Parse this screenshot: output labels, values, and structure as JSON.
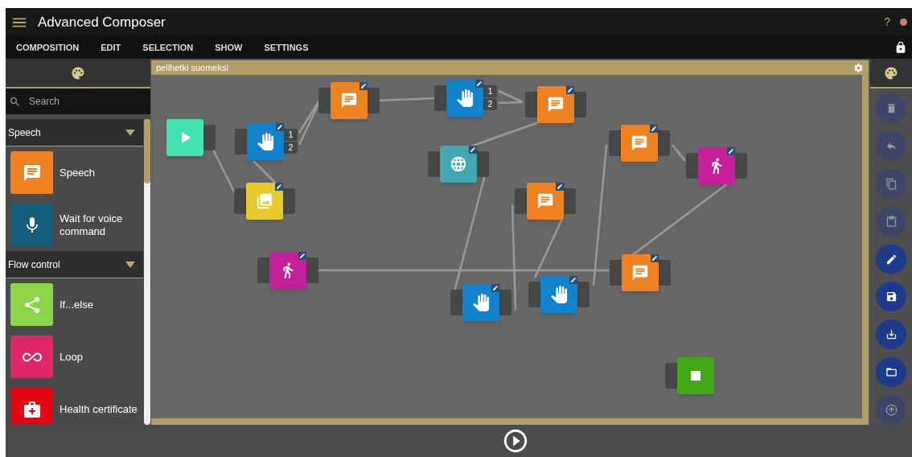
{
  "window": {
    "title": "Advanced Composer"
  },
  "title_bar": {
    "help": "?"
  },
  "menu": [
    "COMPOSITION",
    "EDIT",
    "SELECTION",
    "SHOW",
    "SETTINGS"
  ],
  "palette": {
    "search": {
      "placeholder": "Search"
    },
    "categories": [
      {
        "title": "Speech",
        "expanded": true,
        "items": [
          {
            "kind": "speech",
            "label": "Speech"
          },
          {
            "kind": "voice",
            "label": "Wait for voice command"
          }
        ]
      },
      {
        "title": "Flow control",
        "expanded": true,
        "items": [
          {
            "kind": "ifelse",
            "label": "If...else"
          },
          {
            "kind": "loop",
            "label": "Loop"
          },
          {
            "kind": "health",
            "label": "Health certificate"
          }
        ]
      }
    ]
  },
  "canvas": {
    "title": "pelihetki suomeksi",
    "nodes": [
      {
        "kind": "start"
      },
      {
        "kind": "hand",
        "outputs": [
          "1",
          "2"
        ]
      },
      {
        "kind": "image"
      },
      {
        "kind": "speech"
      },
      {
        "kind": "hand",
        "outputs": [
          "1",
          "2"
        ]
      },
      {
        "kind": "speech"
      },
      {
        "kind": "globe"
      },
      {
        "kind": "speech"
      },
      {
        "kind": "walk"
      },
      {
        "kind": "speech"
      },
      {
        "kind": "walk"
      },
      {
        "kind": "speech"
      },
      {
        "kind": "hand"
      },
      {
        "kind": "hand"
      },
      {
        "kind": "stop"
      }
    ]
  },
  "tools": [
    {
      "kind": "delete",
      "disabled": true
    },
    {
      "kind": "undo",
      "disabled": true
    },
    {
      "kind": "copy",
      "disabled": true
    },
    {
      "kind": "paste",
      "disabled": true
    },
    {
      "kind": "clear",
      "disabled": false
    },
    {
      "kind": "save",
      "disabled": false
    },
    {
      "kind": "save_as",
      "disabled": false
    },
    {
      "kind": "open",
      "disabled": false
    },
    {
      "kind": "upload",
      "disabled": true
    }
  ]
}
